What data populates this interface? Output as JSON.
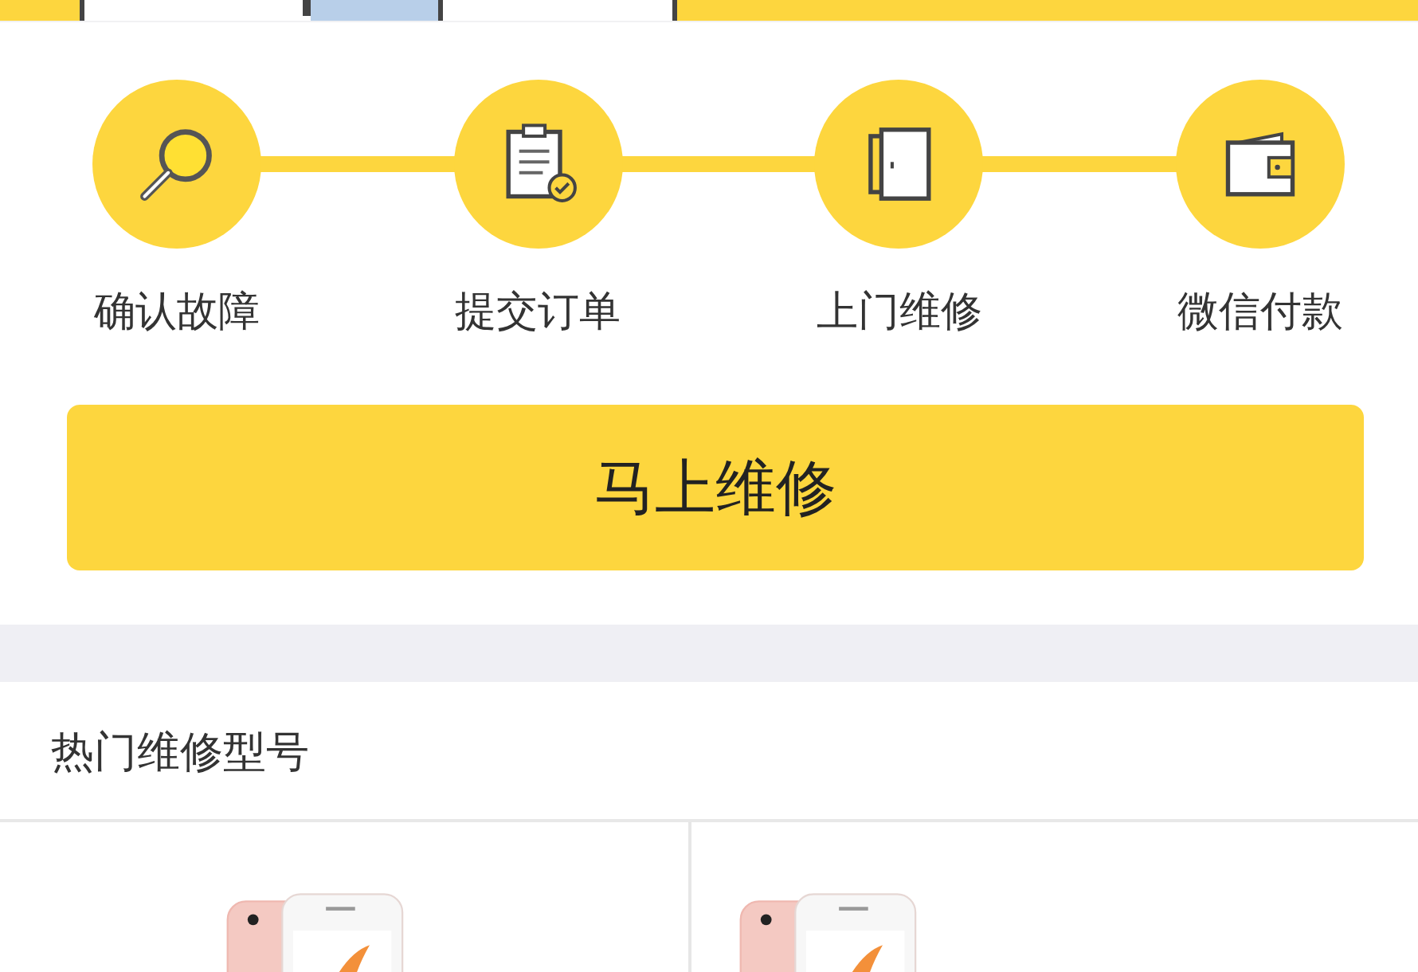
{
  "steps": [
    {
      "label": "确认故障"
    },
    {
      "label": "提交订单"
    },
    {
      "label": "上门维修"
    },
    {
      "label": "微信付款"
    }
  ],
  "repair_button": {
    "label": "马上维修"
  },
  "hot_models": {
    "title": "热门维修型号"
  }
}
